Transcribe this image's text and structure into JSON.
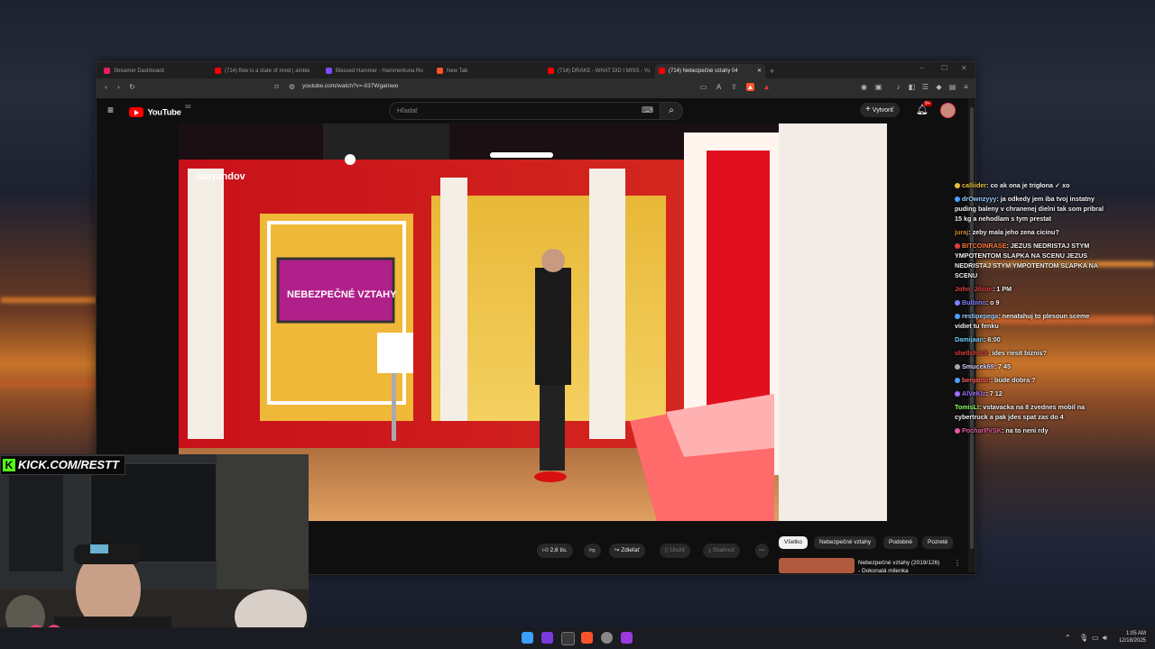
{
  "browser": {
    "tabs": [
      {
        "label": "Streamer Dashboard",
        "color": "#e91e63"
      },
      {
        "label": "(714) flow is a state of mind | ambie",
        "color": "#ff0000"
      },
      {
        "label": "Blessed Hammer - Hammerkuna Ro",
        "color": "#7c4dff"
      },
      {
        "label": "New Tab",
        "color": "#fb542b"
      },
      {
        "label": "(714) DRAKE - WHAT DID I MISS - Yo",
        "color": "#ff0000"
      },
      {
        "label": "(714) Nebezpečné vztahy 04",
        "color": "#ff0000"
      }
    ],
    "url": "youtube.com/watch?v=-lI37WgaInwo"
  },
  "youtube": {
    "logo": "YouTube",
    "region": "SK",
    "search_placeholder": "Hľadať",
    "create_label": "Vytvoriť",
    "notif_count": "9+",
    "actions": {
      "likes": "2,6 tis.",
      "share": "Zdieľať",
      "save": "Uložiť",
      "download": "Stiahnuť"
    },
    "chips": [
      "Všetko",
      "Nebezpečné vztahy",
      "Podobné",
      "Pozreté"
    ],
    "rec": {
      "title": "Nebezpečné vztahy (2019/126)",
      "subtitle": "- Dokonalá milenka"
    },
    "video": {
      "channel_logo": "barrandov",
      "screen_text": "NEBEZPEČNÉ VZTAHY"
    }
  },
  "chat": [
    {
      "user": "calliider",
      "user_color": "#e8c040",
      "text": "co ak ona je trigłona ✓ xo"
    },
    {
      "user": "drOwnzyyy",
      "user_color": "#9ad0ff",
      "text": "ja odkedy jem iba tvoj instatny puding baleny v chranenej dielni tak som pribral 15 kg a nehodlam s tym prestat"
    },
    {
      "user": "juraj",
      "user_color": "#d88a3a",
      "text": "zeby mala jeho zena cicinu?"
    },
    {
      "user": "BITCOINRASE",
      "user_color": "#ff7a3a",
      "text": "JEZUS NEDRISTAJ STYM YMPOTENTOM SLAPKA NA SCENU JEZUS NEDRISTAJ STYM YMPOTENTOM SLAPKA NA SCENU"
    },
    {
      "user": "John_Jilson",
      "user_color": "#e04040",
      "text": "1 PM"
    },
    {
      "user": "Bulbino",
      "user_color": "#8080ff",
      "text": "o 9"
    },
    {
      "user": "restipepega",
      "user_color": "#9ad0ff",
      "text": "nenatahuj to plesoun sceme vidiet tu fenku"
    },
    {
      "user": "Damijaan",
      "user_color": "#6fd0ff",
      "text": "6:00"
    },
    {
      "user": "shellshock",
      "user_color": "#e04040",
      "text": "ides riesit biznis?"
    },
    {
      "user": "Smucek69",
      "user_color": "#d0d0ff",
      "text": "7 45"
    },
    {
      "user": "benjamin",
      "user_color": "#ff5a5a",
      "text": "bude dobra ?"
    },
    {
      "user": "AlVeKIz",
      "user_color": "#a070ff",
      "text": "7 12"
    },
    {
      "user": "TomisLI",
      "user_color": "#8fff6a",
      "text": "vstavacka na 8 zvednes mobil na cybertruck a pak jdes spat zas do 4"
    },
    {
      "user": "PocharPVSK",
      "user_color": "#e05aa0",
      "text": "na to neni rdy"
    }
  ],
  "overlay": {
    "kick_label": "KICK.COM/RESTT"
  },
  "taskbar": {
    "time": "1:05 AM",
    "date": "12/18/2025"
  }
}
